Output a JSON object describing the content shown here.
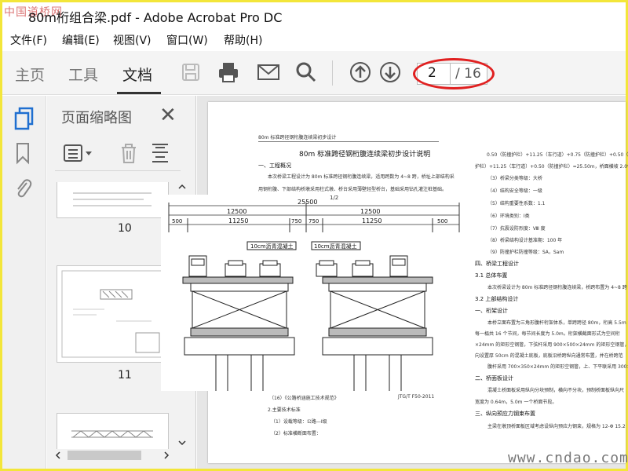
{
  "window": {
    "watermark": "中国道桥网",
    "title": "80m桁组合梁.pdf - Adobe Acrobat Pro DC"
  },
  "menu": [
    "文件(F)",
    "编辑(E)",
    "视图(V)",
    "窗口(W)",
    "帮助(H)"
  ],
  "tabs": [
    "主页",
    "工具",
    "文档"
  ],
  "active_tab": "文档",
  "toolbar": {
    "icons": [
      "save-icon",
      "print-icon",
      "mail-icon",
      "search-icon",
      "page-up-icon",
      "page-down-icon"
    ],
    "page_current": "2",
    "page_total": "/ 16",
    "highlight_color": "#e02020"
  },
  "thumbnails_panel": {
    "title": "页面缩略图",
    "close": "✕",
    "pages": [
      "10",
      "11"
    ]
  },
  "document": {
    "header": "80m 标准跨径钢桁腹连续梁初步设计",
    "title": "80m 标准跨径钢桁腹连续梁初步设计说明",
    "left_col": [
      "一、工程概况",
      "本次桥梁工程设计为 80m 标准跨径钢桁腹连续梁，适用跨数为 4~8 跨，桥址上部结构采",
      "用钢桁腹、下部结构桥墩采用柱式墩、桥台采用薄壁轻型桥台，基础采用钻孔灌注桩基础。",
      "（16）《公路桥涵施工技术规范》",
      "JTG/T F50-2011",
      "2.主要技术标准",
      "（1）设载等级：公路—Ⅰ级",
      "（2）标准横断面布置："
    ],
    "right_col": [
      "0.50（防撞护栏）+11.25（车行道）+0.75（防撞护栏）+0.50（",
      "护栏）+11.25（车行道）+0.50（防撞护栏）=25.50m，桥面横坡 2.0%",
      "（3）桥梁分类等级：大桥",
      "（4）结构安全等级：一级",
      "（5）结构重要性系数：1.1",
      "（6）环境类别：Ⅰ类",
      "（7）抗震设防烈度：Ⅷ 度",
      "（8）桥梁结构设计基准期：100 年",
      "（9）防撞护栏防撞等级：SA，Sam",
      "四、桥梁工程设计",
      "3.1 总体布置",
      "本次桥梁设计为 80m 标准跨径钢桁腹连续梁，桥跨布置为 4~8 跨",
      "3.2 上部结构设计",
      "一、桁架设计",
      "本桥立面布置为三角形腹杆桁架体系，单跨跨径 80m，桁高 5.5m",
      "每一榀共 16 个节间，每节间长度为 5.0m。桁架横截面形式为空间桁",
      "×24mm 的矩形空钢管，下弦杆采用 900×500×24mm 的矩形空钢管，下",
      "向设置厚 50cm 的混凝土底板，底板沿桥跨纵向通常布置，并在桥跨范",
      "腹杆采用 700×350×24mm 的矩形空钢管，上、下平联采用 300×",
      "二、桥面板设计",
      "混凝土桥面板采用纵向分块预制，横向不分块，预制桥面板纵向尺",
      "宽度为 0.64m，5.0m 一个桥面节段。",
      "三、纵向预应力钢束布置",
      "主梁在墩顶桥面板区域考虑设纵向预应力钢束，规格为 12-Φ 15.2"
    ]
  },
  "drawing": {
    "top_label": "1/2",
    "total_width": "25500",
    "half_widths": [
      "12500",
      "12500"
    ],
    "dims_row": [
      "500",
      "11250",
      "750",
      "750",
      "11250",
      "500"
    ],
    "road_labels": [
      "10cm沥青混凝土",
      "10cm沥青混凝土"
    ]
  },
  "site_watermark": "www.cndao.com"
}
